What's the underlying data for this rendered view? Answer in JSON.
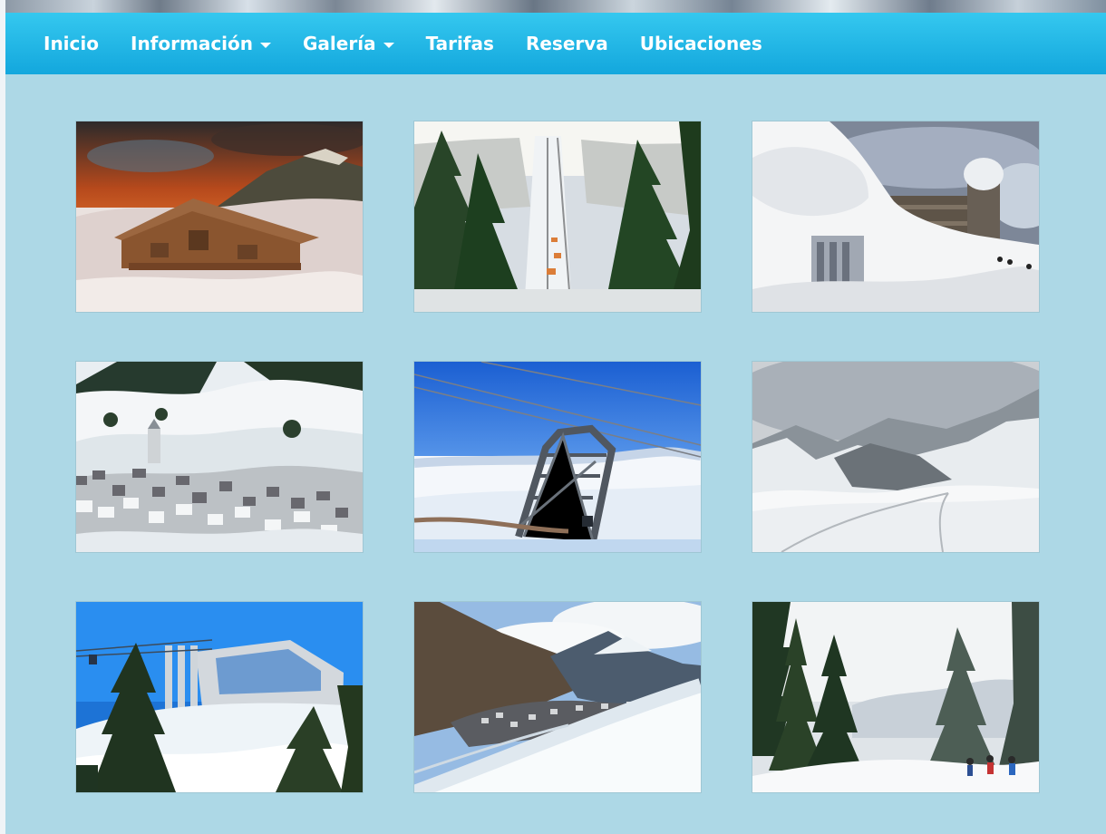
{
  "nav": {
    "items": [
      {
        "label": "Inicio"
      },
      {
        "label": "Información"
      },
      {
        "label": "Galería"
      },
      {
        "label": "Tarifas"
      },
      {
        "label": "Reserva"
      },
      {
        "label": "Ubicaciones"
      }
    ]
  }
}
